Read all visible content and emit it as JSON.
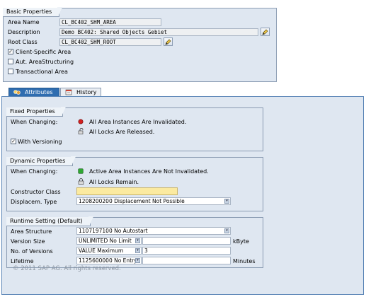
{
  "basic_properties": {
    "title": "Basic Properties",
    "area_name_label": "Area Name",
    "area_name_value": "CL_BC402_SHM_AREA",
    "description_label": "Description",
    "description_value": "Demo BC402: Shared Objects Gebiet",
    "root_class_label": "Root Class",
    "root_class_value": "CL_BC402_SHM_ROOT",
    "client_specific_label": "Client-Specific Area",
    "client_specific_checked": true,
    "aut_area_structuring_label": "Aut. AreaStructuring",
    "aut_area_structuring_checked": false,
    "transactional_label": "Transactional Area",
    "transactional_checked": false
  },
  "tabs": {
    "attributes_label": "Attributes",
    "history_label": "History"
  },
  "fixed_properties": {
    "title": "Fixed Properties",
    "when_changing_label": "When Changing:",
    "status1_text": "All Area Instances Are Invalidated.",
    "status2_text": "All Locks Are Released.",
    "with_versioning_label": "With Versioning",
    "with_versioning_checked": true
  },
  "dynamic_properties": {
    "title": "Dynamic Properties",
    "when_changing_label": "When Changing:",
    "status1_text": "Active Area Instances Are Not Invalidated.",
    "status2_text": "All Locks Remain.",
    "constructor_class_label": "Constructor Class",
    "constructor_class_value": "",
    "displacem_type_label": "Displacem. Type",
    "displacem_type_value": "1208200200 Displacement Not Possible"
  },
  "runtime_setting": {
    "title": "Runtime Setting (Default)",
    "area_structure_label": "Area Structure",
    "area_structure_value": "1107197100 No Autostart",
    "version_size_label": "Version Size",
    "version_size_value": "UNLIMITED No Limit",
    "version_size_unit": "kByte",
    "no_of_versions_label": "No. of Versions",
    "no_of_versions_value": "VALUE Maximum",
    "no_of_versions_number": "3",
    "lifetime_label": "Lifetime",
    "lifetime_value": "1125600000 No Entry",
    "lifetime_unit": "Minutes"
  },
  "footer": {
    "copyright": "© 2011 SAP AG. All rights reserved."
  },
  "colors": {
    "panel_bg": "#dfe7f1",
    "active_tab": "#2f6db0",
    "required_field": "#fbeaa0",
    "status_red": "#d42020",
    "status_green": "#2fa832"
  },
  "icons": {
    "pencil": "pencil-icon",
    "dropdown": "dropdown-arrow-icon",
    "attributes_tab": "attributes-icon",
    "history_tab": "history-icon",
    "red_light": "red-status-icon",
    "green_light": "green-status-icon",
    "lock_open": "unlock-icon",
    "lock_closed": "lock-icon"
  }
}
